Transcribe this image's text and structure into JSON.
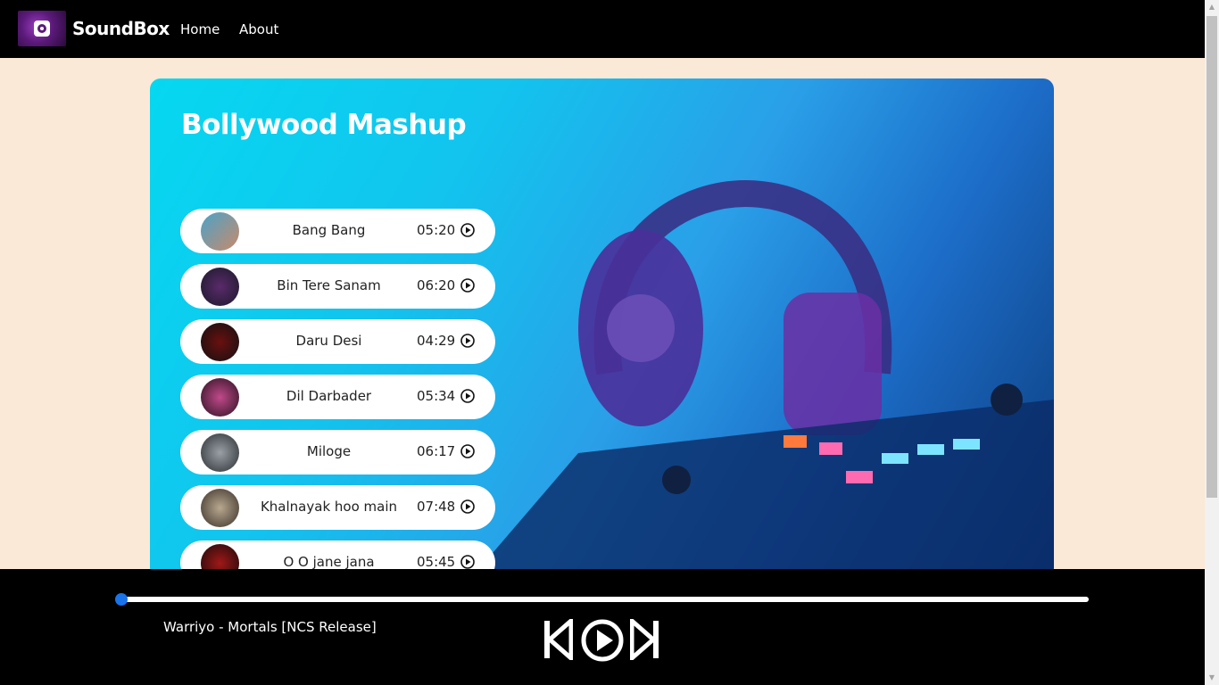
{
  "app": {
    "brand": "SoundBox"
  },
  "nav": {
    "home": "Home",
    "about": "About"
  },
  "playlist": {
    "title": "Bollywood Mashup",
    "songs": [
      {
        "name": "Bang Bang",
        "duration": "05:20"
      },
      {
        "name": "Bin Tere Sanam",
        "duration": "06:20"
      },
      {
        "name": "Daru Desi",
        "duration": "04:29"
      },
      {
        "name": "Dil Darbader",
        "duration": "05:34"
      },
      {
        "name": "Miloge",
        "duration": "06:17"
      },
      {
        "name": "Khalnayak hoo main",
        "duration": "07:48"
      },
      {
        "name": "O O jane jana",
        "duration": "05:45"
      }
    ]
  },
  "player": {
    "now_playing": "Warriyo - Mortals [NCS Release]",
    "progress": 0,
    "icons": {
      "prev": "skip-previous-icon",
      "play": "play-circle-icon",
      "next": "skip-next-icon"
    },
    "accent": "#1a73e8"
  },
  "colors": {
    "page_bg": "#fae9d6",
    "nav_bg": "#000000",
    "card_gradient_start": "#06d8f0"
  }
}
